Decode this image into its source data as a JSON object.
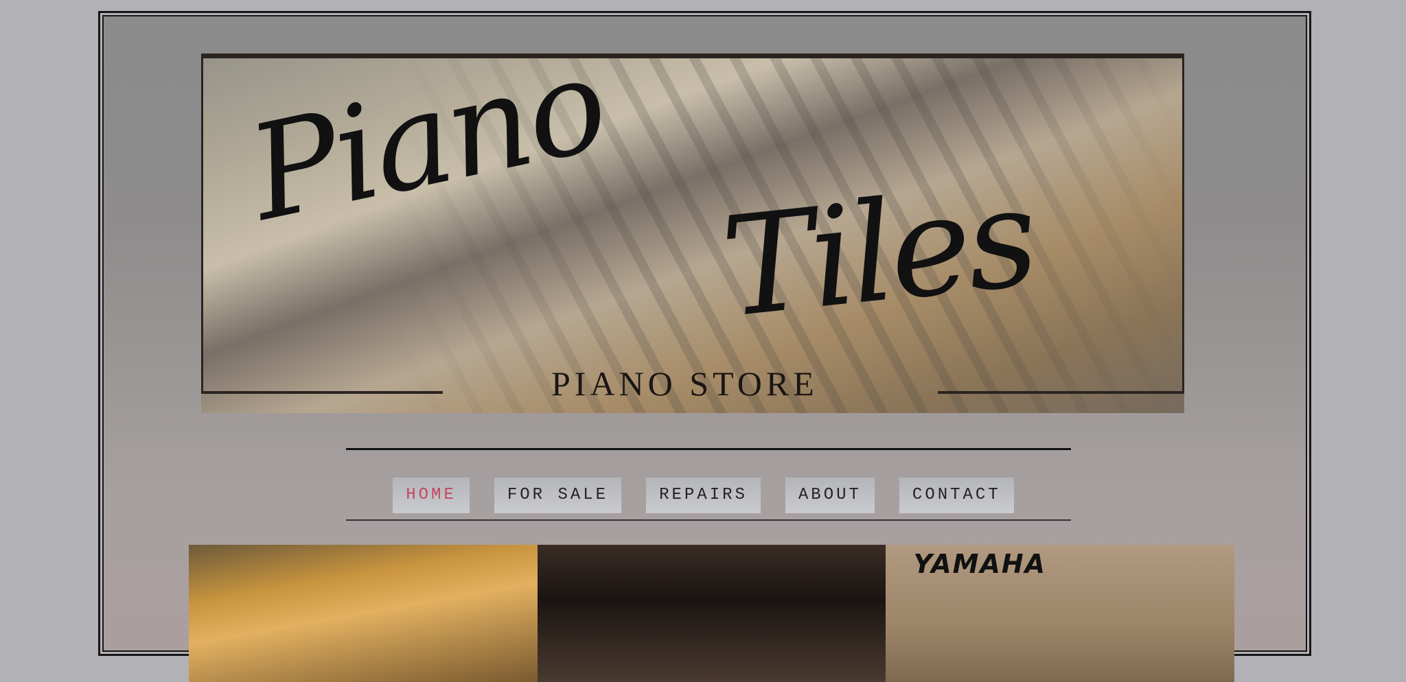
{
  "banner": {
    "logo_script": "Piano Tiles",
    "logo_word1": "Piano",
    "logo_word2": "Tiles",
    "subtitle": "PIANO STORE"
  },
  "nav": {
    "items": [
      {
        "label": "HOME",
        "active": true
      },
      {
        "label": "FOR SALE"
      },
      {
        "label": "REPAIRS"
      },
      {
        "label": "ABOUT"
      },
      {
        "label": "CONTACT"
      }
    ],
    "active_color": "#c5475f"
  },
  "gallery": {
    "brand_text": "YAMAHA"
  }
}
